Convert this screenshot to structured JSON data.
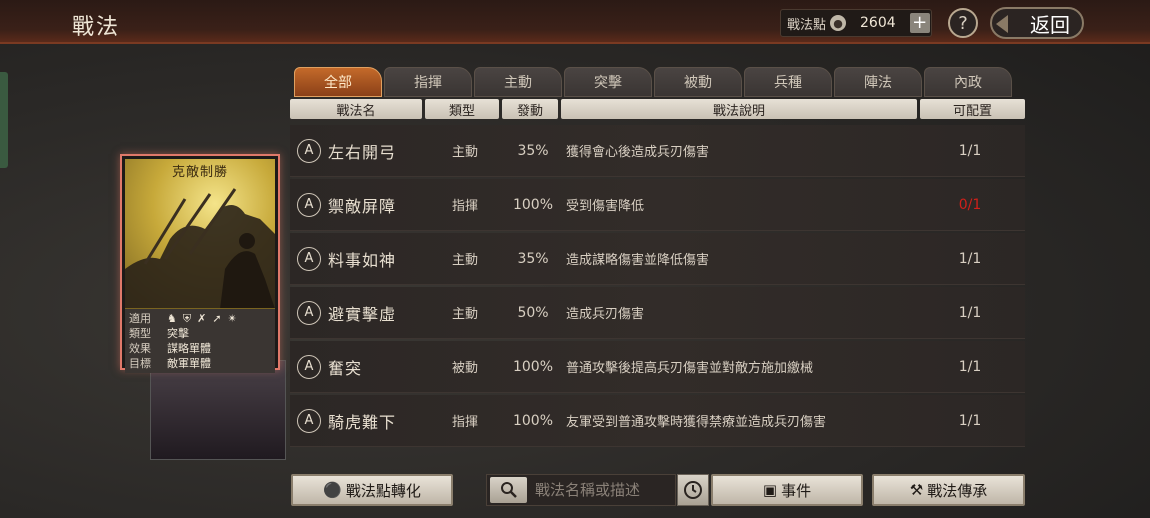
{
  "header": {
    "title": "戰法",
    "points_label": "戰法點",
    "points_value": "2604",
    "plus_label": "+",
    "help_label": "?",
    "back_label": "返回"
  },
  "tabs": [
    {
      "label": "全部",
      "active": true
    },
    {
      "label": "指揮",
      "active": false
    },
    {
      "label": "主動",
      "active": false
    },
    {
      "label": "突擊",
      "active": false
    },
    {
      "label": "被動",
      "active": false
    },
    {
      "label": "兵種",
      "active": false
    },
    {
      "label": "陣法",
      "active": false
    },
    {
      "label": "內政",
      "active": false
    }
  ],
  "columns": [
    "戰法名",
    "類型",
    "發動",
    "戰法說明",
    "可配置"
  ],
  "tactics": [
    {
      "grade": "A",
      "name": "左右開弓",
      "type": "主動",
      "rate": "35%",
      "desc": "獲得會心後造成兵刃傷害",
      "slots": "1/1",
      "slots_full": false
    },
    {
      "grade": "A",
      "name": "禦敵屏障",
      "type": "指揮",
      "rate": "100%",
      "desc": "受到傷害降低",
      "slots": "0/1",
      "slots_full": true
    },
    {
      "grade": "A",
      "name": "料事如神",
      "type": "主動",
      "rate": "35%",
      "desc": "造成謀略傷害並降低傷害",
      "slots": "1/1",
      "slots_full": false
    },
    {
      "grade": "A",
      "name": "避實擊虛",
      "type": "主動",
      "rate": "50%",
      "desc": "造成兵刃傷害",
      "slots": "1/1",
      "slots_full": false
    },
    {
      "grade": "A",
      "name": "奮突",
      "type": "被動",
      "rate": "100%",
      "desc": "普通攻擊後提高兵刃傷害並對敵方施加繳械",
      "slots": "1/1",
      "slots_full": false
    },
    {
      "grade": "A",
      "name": "騎虎難下",
      "type": "指揮",
      "rate": "100%",
      "desc": "友軍受到普通攻擊時獲得禁療並造成兵刃傷害",
      "slots": "1/1",
      "slots_full": false
    }
  ],
  "card": {
    "name": "克敵制勝",
    "applies_label": "適用",
    "type_label": "類型",
    "type_value": "突擊",
    "effect_label": "效果",
    "effect_value": "謀略單體",
    "target_label": "目標",
    "target_value": "敵軍單體"
  },
  "bottom": {
    "convert_label": "戰法點轉化",
    "search_placeholder": "戰法名稱或描述",
    "event_label": "事件",
    "inherit_label": "戰法傳承"
  },
  "colors": {
    "active_tab": "#c46a2a",
    "slot_full": "#d0201a",
    "card_border": "#e0796a"
  }
}
